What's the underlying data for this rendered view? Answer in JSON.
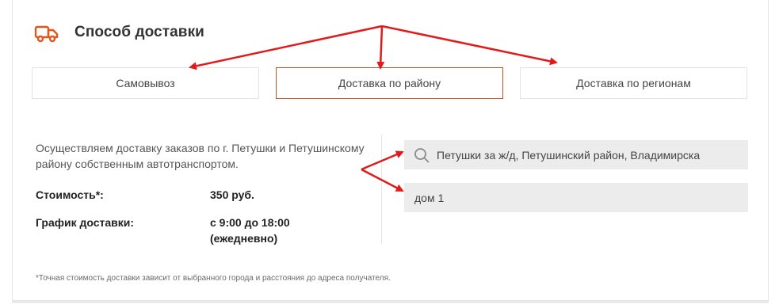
{
  "section": {
    "title": "Способ доставки",
    "icon": "truck-icon",
    "accent_color": "#e0561c"
  },
  "tabs": [
    {
      "label": "Самовывоз",
      "active": false
    },
    {
      "label": "Доставка по району",
      "active": true
    },
    {
      "label": "Доставка по регионам",
      "active": false
    }
  ],
  "details": {
    "description": "Осуществляем доставку заказов по г. Петушки и Петушинскому району собственным автотранспортом.",
    "cost_label": "Стоимость*:",
    "cost_value": "350 руб.",
    "schedule_label": "График доставки:",
    "schedule_value": "с 9:00 до 18:00 (ежедневно)"
  },
  "address_form": {
    "address_value": "Петушки за ж/д, Петушинский район, Владимирска",
    "address_icon": "search-icon",
    "house_value": "дом 1"
  },
  "footnote": "*Точная стоимость доставки зависит от выбранного города и расстояния до адреса получателя.",
  "annotation_color": "#e11b1b"
}
